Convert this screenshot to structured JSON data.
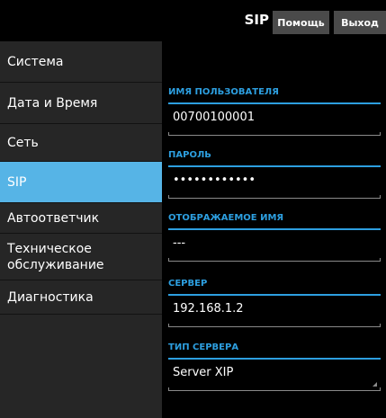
{
  "header": {
    "title": "SIP",
    "help_label": "Помощь",
    "exit_label": "Выход"
  },
  "sidebar": {
    "items": [
      {
        "label": "Система"
      },
      {
        "label": "Дата и Время"
      },
      {
        "label": "Сеть"
      },
      {
        "label": "SIP"
      },
      {
        "label": "Автоответчик"
      },
      {
        "label": "Техническое обслуживание"
      },
      {
        "label": "Диагностика"
      }
    ],
    "active_index": 3
  },
  "form": {
    "username": {
      "label": "ИМЯ ПОЛЬЗОВАТЕЛЯ",
      "value": "00700100001"
    },
    "password": {
      "label": "ПАРОЛЬ",
      "value": "••••••••••••"
    },
    "display_name": {
      "label": "ОТОБРАЖАЕМОЕ ИМЯ",
      "value": "---"
    },
    "server": {
      "label": "СЕРВЕР",
      "value": "192.168.1.2"
    },
    "server_type": {
      "label": "ТИП СЕРВЕРА",
      "value": "Server XIP"
    }
  },
  "colors": {
    "accent": "#2d9fe0",
    "active_item": "#56b4e6",
    "sidebar_bg": "#262626",
    "button_bg": "#4a4a4a"
  }
}
